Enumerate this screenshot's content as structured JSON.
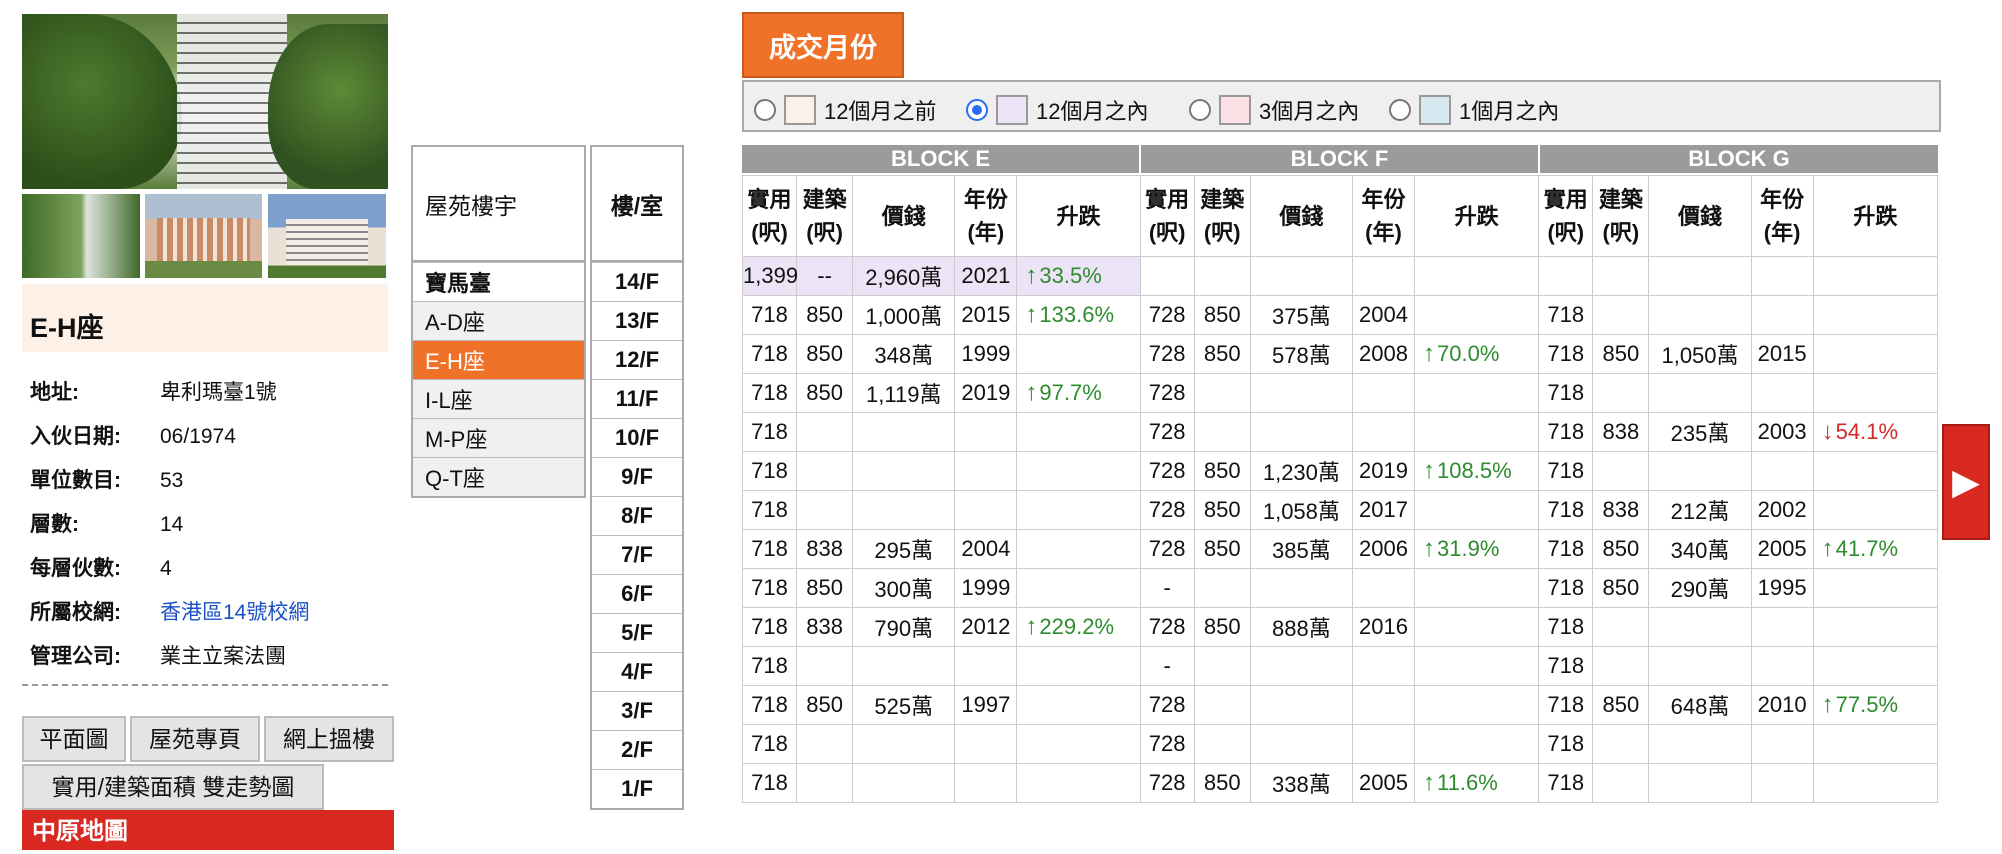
{
  "estate": {
    "name": "E-H座",
    "info": [
      {
        "key": "地址:",
        "value": "卑利瑪臺1號",
        "link": false
      },
      {
        "key": "入伙日期:",
        "value": "06/1974",
        "link": false
      },
      {
        "key": "單位數目:",
        "value": "53",
        "link": false
      },
      {
        "key": "層數:",
        "value": "14",
        "link": false
      },
      {
        "key": "每層伙數:",
        "value": "4",
        "link": false
      },
      {
        "key": "所屬校網:",
        "value": "香港區14號校網",
        "link": true
      },
      {
        "key": "管理公司:",
        "value": "業主立案法團",
        "link": false
      }
    ],
    "buttons": [
      "平面圖",
      "屋苑專頁",
      "網上搵樓",
      "實用/建築面積 雙走勢圖"
    ],
    "map_button": "中原地圖"
  },
  "block_list": {
    "header": "屋苑樓宇",
    "items": [
      "寶馬臺",
      "A-D座",
      "E-H座",
      "I-L座",
      "M-P座",
      "Q-T座"
    ],
    "selected_index": 2
  },
  "floors": {
    "header": "樓/室",
    "items": [
      "14/F",
      "13/F",
      "12/F",
      "11/F",
      "10/F",
      "9/F",
      "8/F",
      "7/F",
      "6/F",
      "5/F",
      "4/F",
      "3/F",
      "2/F",
      "1/F"
    ]
  },
  "filter": {
    "tab_label": "成交月份",
    "options": [
      {
        "label": "12個月之前",
        "color": "#fdf0e6",
        "checked": false
      },
      {
        "label": "12個月之內",
        "color": "#ece3f6",
        "checked": true
      },
      {
        "label": "3個月之內",
        "color": "#fbe0e6",
        "checked": false
      },
      {
        "label": "1個月之內",
        "color": "#d6e8f0",
        "checked": false
      }
    ]
  },
  "table": {
    "blocks": [
      "BLOCK E",
      "BLOCK F",
      "BLOCK G"
    ],
    "columns": [
      "實用\n(呎)",
      "建築\n(呎)",
      "價錢",
      "年份\n(年)",
      "升跌"
    ],
    "rows": [
      {
        "E": [
          "1,399",
          "--",
          "2,960萬",
          "2021",
          "+33.5%"
        ],
        "F": [
          "",
          "",
          "",
          "",
          ""
        ],
        "G": [
          "",
          "",
          "",
          "",
          ""
        ],
        "highlight_E": true
      },
      {
        "E": [
          "718",
          "850",
          "1,000萬",
          "2015",
          "+133.6%"
        ],
        "F": [
          "728",
          "850",
          "375萬",
          "2004",
          ""
        ],
        "G": [
          "718",
          "",
          "",
          "",
          ""
        ]
      },
      {
        "E": [
          "718",
          "850",
          "348萬",
          "1999",
          ""
        ],
        "F": [
          "728",
          "850",
          "578萬",
          "2008",
          "+70.0%"
        ],
        "G": [
          "718",
          "850",
          "1,050萬",
          "2015",
          ""
        ]
      },
      {
        "E": [
          "718",
          "850",
          "1,119萬",
          "2019",
          "+97.7%"
        ],
        "F": [
          "728",
          "",
          "",
          "",
          ""
        ],
        "G": [
          "718",
          "",
          "",
          "",
          ""
        ]
      },
      {
        "E": [
          "718",
          "",
          "",
          "",
          ""
        ],
        "F": [
          "728",
          "",
          "",
          "",
          ""
        ],
        "G": [
          "718",
          "838",
          "235萬",
          "2003",
          "-54.1%"
        ]
      },
      {
        "E": [
          "718",
          "",
          "",
          "",
          ""
        ],
        "F": [
          "728",
          "850",
          "1,230萬",
          "2019",
          "+108.5%"
        ],
        "G": [
          "718",
          "",
          "",
          "",
          ""
        ]
      },
      {
        "E": [
          "718",
          "",
          "",
          "",
          ""
        ],
        "F": [
          "728",
          "850",
          "1,058萬",
          "2017",
          ""
        ],
        "G": [
          "718",
          "838",
          "212萬",
          "2002",
          ""
        ]
      },
      {
        "E": [
          "718",
          "838",
          "295萬",
          "2004",
          ""
        ],
        "F": [
          "728",
          "850",
          "385萬",
          "2006",
          "+31.9%"
        ],
        "G": [
          "718",
          "850",
          "340萬",
          "2005",
          "+41.7%"
        ]
      },
      {
        "E": [
          "718",
          "850",
          "300萬",
          "1999",
          ""
        ],
        "F": [
          "-",
          "",
          "",
          "",
          ""
        ],
        "G": [
          "718",
          "850",
          "290萬",
          "1995",
          ""
        ]
      },
      {
        "E": [
          "718",
          "838",
          "790萬",
          "2012",
          "+229.2%"
        ],
        "F": [
          "728",
          "850",
          "888萬",
          "2016",
          ""
        ],
        "G": [
          "718",
          "",
          "",
          "",
          ""
        ]
      },
      {
        "E": [
          "718",
          "",
          "",
          "",
          ""
        ],
        "F": [
          "-",
          "",
          "",
          "",
          ""
        ],
        "G": [
          "718",
          "",
          "",
          "",
          ""
        ]
      },
      {
        "E": [
          "718",
          "850",
          "525萬",
          "1997",
          ""
        ],
        "F": [
          "728",
          "",
          "",
          "",
          ""
        ],
        "G": [
          "718",
          "850",
          "648萬",
          "2010",
          "+77.5%"
        ]
      },
      {
        "E": [
          "718",
          "",
          "",
          "",
          ""
        ],
        "F": [
          "728",
          "",
          "",
          "",
          ""
        ],
        "G": [
          "718",
          "",
          "",
          "",
          ""
        ]
      },
      {
        "E": [
          "718",
          "",
          "",
          "",
          ""
        ],
        "F": [
          "728",
          "850",
          "338萬",
          "2005",
          "+11.6%"
        ],
        "G": [
          "718",
          "",
          "",
          "",
          ""
        ]
      }
    ]
  },
  "colors": {
    "accent_orange": "#f07228",
    "up_green": "#2e8b2e",
    "down_red": "#d72828",
    "map_red": "#d9281f"
  }
}
